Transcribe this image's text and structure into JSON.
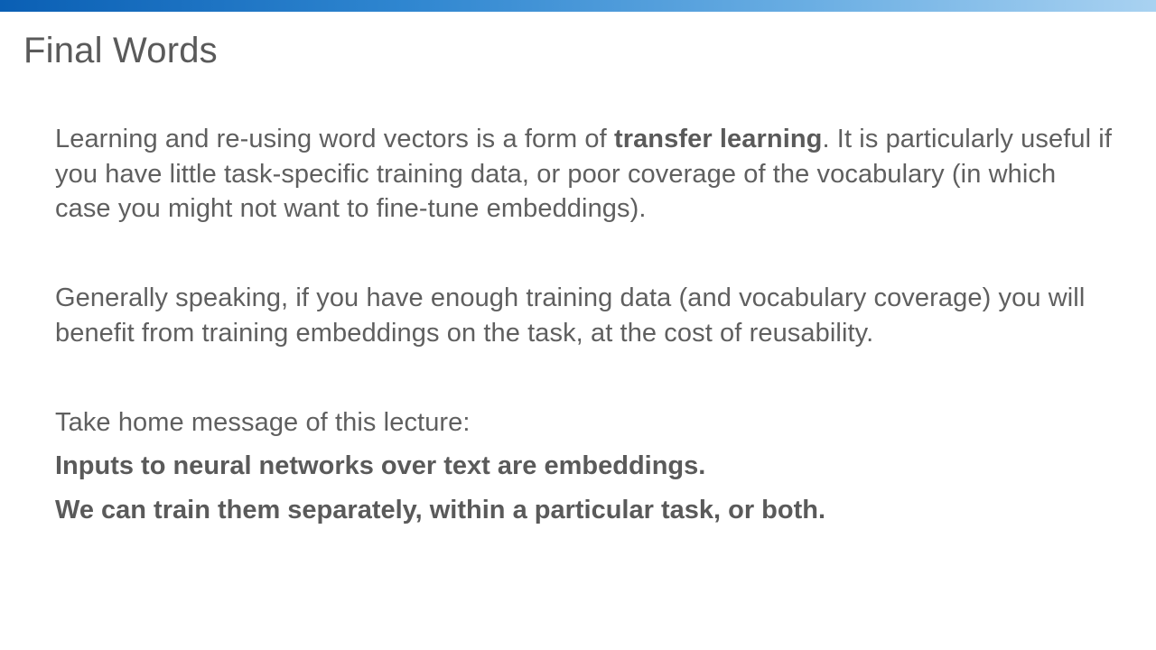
{
  "slide": {
    "title": "Final Words",
    "paragraph1": {
      "before": "Learning and re-using word vectors is a form of ",
      "bold": "transfer learning",
      "after": ". It is particularly useful if you have little task-specific training data, or poor coverage of the vocabulary (in which case you might not want to fine-tune embeddings)."
    },
    "paragraph2": "Generally speaking, if you have enough training data (and vocabulary coverage) you will benefit from training embeddings on the task, at the cost of reusability.",
    "takeaway_intro": "Take home message of this lecture:",
    "takeaway_lines": [
      "Inputs to neural networks over text are embeddings.",
      "We can train them separately, within a particular task, or both."
    ]
  },
  "colors": {
    "accent_bar_start": "#0a5fb4",
    "accent_bar_end": "#a9d2f1",
    "text": "#5f5f5f",
    "background": "#ffffff"
  }
}
